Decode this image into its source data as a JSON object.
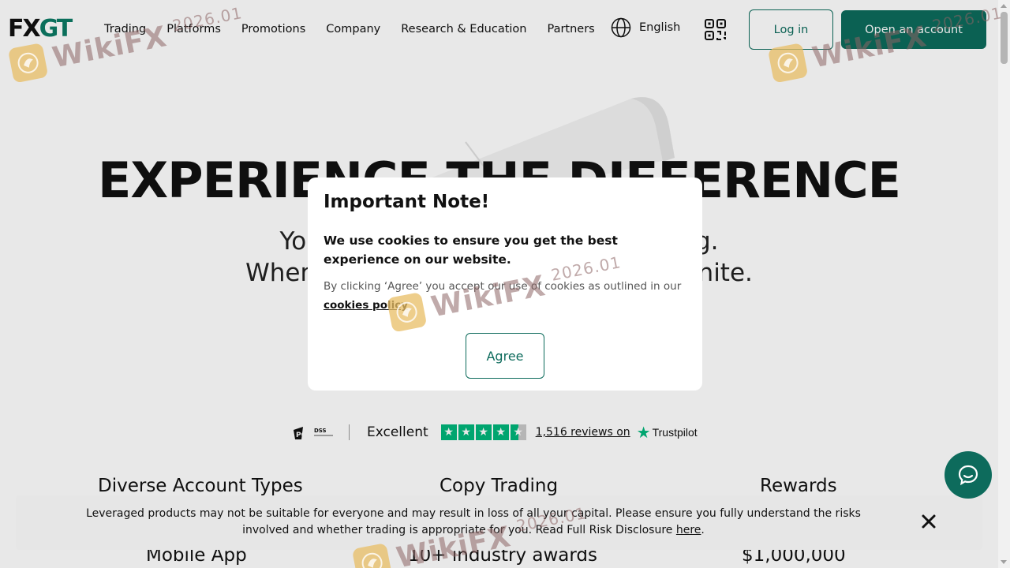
{
  "brand": {
    "logo_left": "FX",
    "logo_right": "GT"
  },
  "nav": {
    "items": [
      "Trading",
      "Platforms",
      "Promotions",
      "Company",
      "Research & Education",
      "Partners"
    ],
    "language": "English",
    "login_label": "Log in",
    "open_account_label": "Open an account"
  },
  "hero": {
    "title": "EXPERIENCE THE DIFFERENCE",
    "subtitle_line1": "Yo                                                  g.",
    "subtitle_line2": "Where                                              unite."
  },
  "trust": {
    "excellent": "Excellent",
    "rating_stars": 4.5,
    "reviews_link": "1,516 reviews on",
    "trustpilot": "Trustpilot"
  },
  "features": {
    "row1": [
      "Diverse Account Types",
      "Copy Trading",
      "Rewards"
    ],
    "row2": [
      "Mobile App",
      "10+ industry awards",
      "$1,000,000"
    ]
  },
  "modal": {
    "title": "Important Note!",
    "lead": "We use cookies to ensure you get the best experience on our website.",
    "text_prefix": "By clicking ‘Agree’ you accept our use of cookies as outlined in our ",
    "policy_link": "cookies policy",
    "agree_label": "Agree"
  },
  "risk": {
    "text": "Leveraged products may not be suitable for everyone and may result in loss of all your capital. Please ensure you fully understand the risks involved and whether trading is appropriate for you. Read Full Risk Disclosure ",
    "link": "here",
    "suffix": "."
  },
  "watermark": {
    "text": "WikiFX",
    "year": "2026.01"
  },
  "colors": {
    "brand": "#0d6b5c",
    "trustpilot": "#00b67a"
  }
}
